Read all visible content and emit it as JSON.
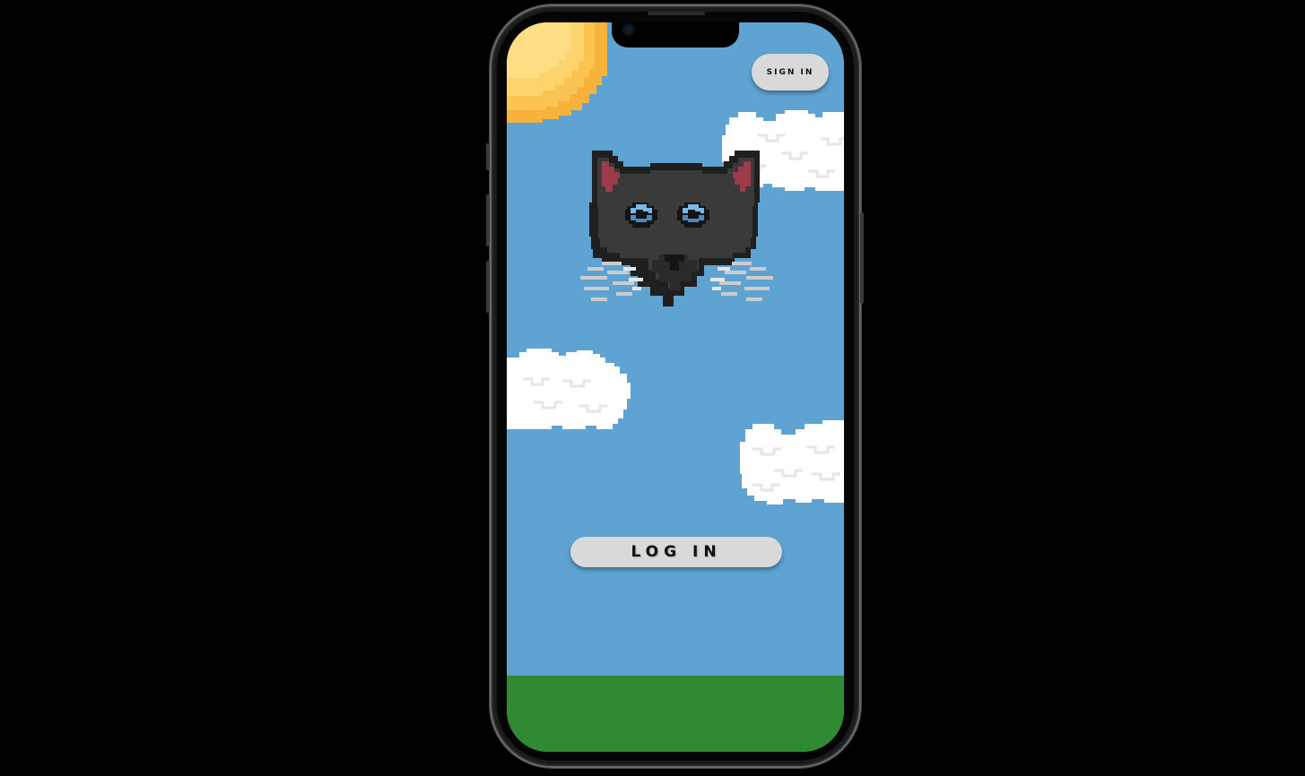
{
  "buttons": {
    "sign_in_label": "SIGN IN",
    "log_in_label": "LOG IN"
  },
  "colors": {
    "sky": "#5fa3d2",
    "grass": "#2f8a32",
    "sun": "#fbc04a",
    "cloud": "#ffffff",
    "cat_fur": "#3a3a3a",
    "cat_eyes": "#6fb3e6",
    "button": "#d9d9d9"
  },
  "icons": {
    "sun": "sun-icon",
    "cat": "cat-head-icon",
    "cloud": "cloud-icon"
  }
}
